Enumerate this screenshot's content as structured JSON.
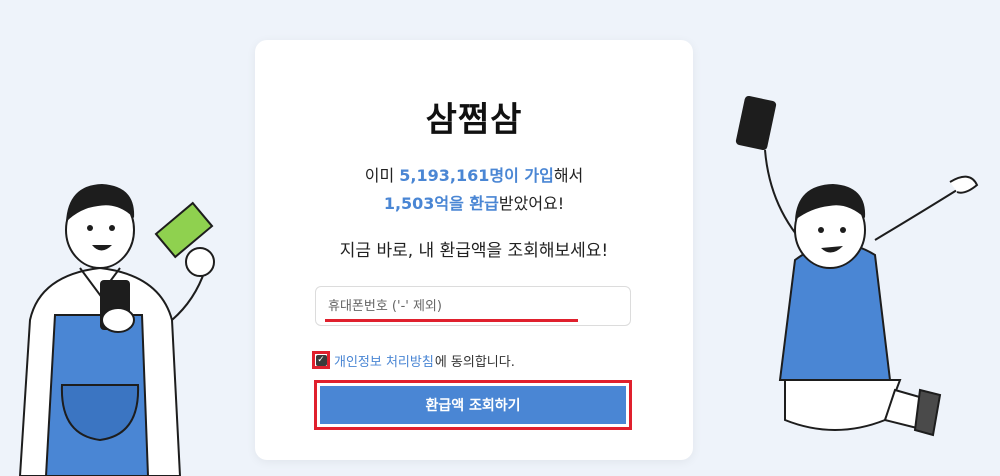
{
  "brand": {
    "title": "삼쩜삼"
  },
  "stats": {
    "prefix": "이미 ",
    "member_count": "5,193,161명이 가입",
    "suffix1": "해서",
    "refund_total": "1,503억을 환급",
    "suffix2": "받았어요!"
  },
  "subtitle": "지금 바로, 내 환급액을 조회해보세요!",
  "phone_input": {
    "placeholder": "휴대폰번호 ('-' 제외)",
    "value": ""
  },
  "agreement": {
    "checked": true,
    "link_label": "개인정보 처리방침",
    "text": "에 동의합니다."
  },
  "submit_label": "환급액 조회하기",
  "colors": {
    "accent": "#4a86d4",
    "highlight_red": "#e0202d",
    "background": "#eef3fa"
  },
  "icons": {
    "checkbox": "check-icon"
  }
}
